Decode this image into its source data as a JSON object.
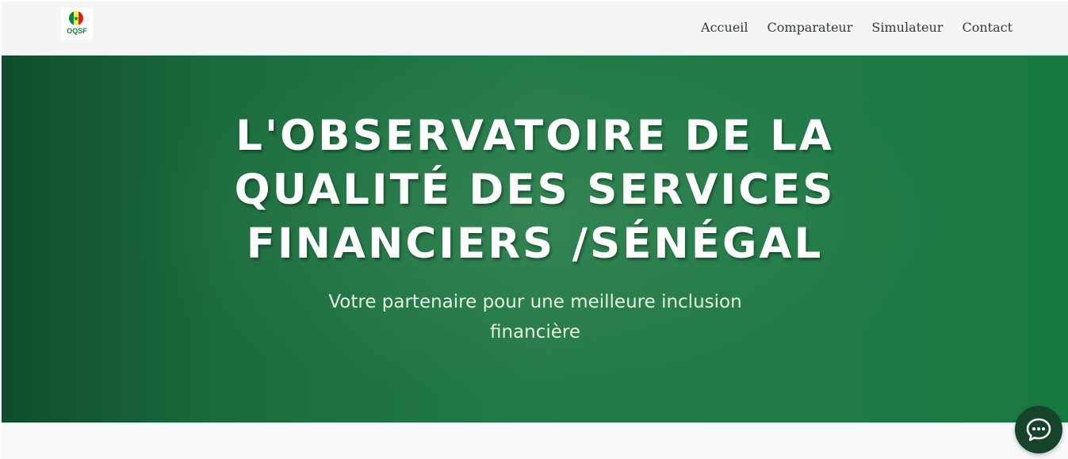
{
  "brand": {
    "logo_text": "OQSF",
    "icon": "senegal-flag-logo-icon",
    "flag_colors": [
      "#00853f",
      "#fdef42",
      "#e31b23"
    ]
  },
  "nav": {
    "items": [
      {
        "label": "Accueil"
      },
      {
        "label": "Comparateur"
      },
      {
        "label": "Simulateur"
      },
      {
        "label": "Contact"
      }
    ]
  },
  "hero": {
    "title_lines": [
      "L'OBSERVATOIRE DE LA",
      "QUALITÉ DES SERVICES",
      "FINANCIERS /SÉNÉGAL"
    ],
    "subtitle": "Votre partenaire pour une meilleure inclusion financière",
    "colors": {
      "gradient_dark": "#0f4d2c",
      "gradient_light": "#237a48"
    }
  },
  "chat": {
    "icon": "chat-bubble-icon",
    "color": "#15442b"
  }
}
